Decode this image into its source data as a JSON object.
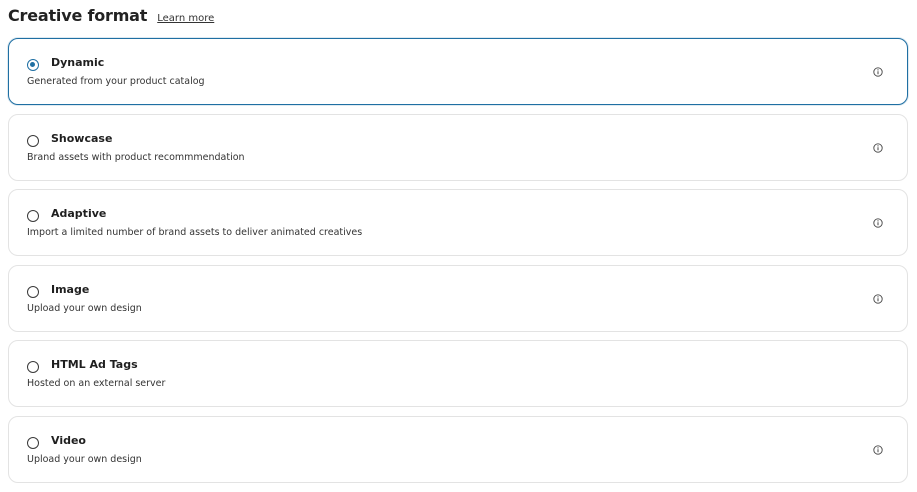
{
  "header": {
    "title": "Creative format",
    "learn_more": "Learn more"
  },
  "options": [
    {
      "label": "Dynamic",
      "description": "Generated from your product catalog",
      "selected": true,
      "has_info": true
    },
    {
      "label": "Showcase",
      "description": "Brand assets with product recommmendation",
      "selected": false,
      "has_info": true
    },
    {
      "label": "Adaptive",
      "description": "Import a limited number of brand assets to deliver animated creatives",
      "selected": false,
      "has_info": true
    },
    {
      "label": "Image",
      "description": "Upload your own design",
      "selected": false,
      "has_info": true
    },
    {
      "label": "HTML Ad Tags",
      "description": "Hosted on an external server",
      "selected": false,
      "has_info": false
    },
    {
      "label": "Video",
      "description": "Upload your own design",
      "selected": false,
      "has_info": true
    }
  ],
  "icons": {
    "info": "info-circle-icon",
    "radio": "radio-button"
  },
  "colors": {
    "accent": "#1f6fa3",
    "border": "#e3e3e3",
    "text": "#1f1f1f"
  }
}
